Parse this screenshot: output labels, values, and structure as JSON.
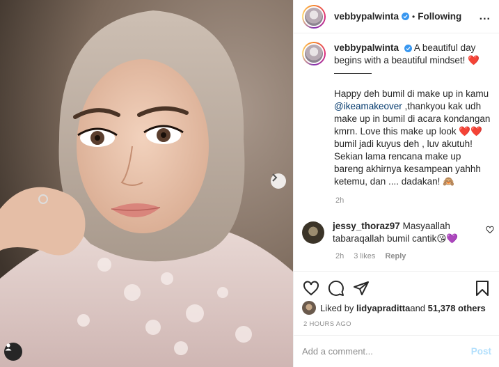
{
  "post": {
    "username": "vebbypalwinta",
    "following_label": "Following",
    "separator": "•",
    "more_label": "...",
    "photo_alt": "hijab portrait"
  },
  "caption": {
    "username": "vebbypalwinta",
    "line1": "A beautiful day begins with a beautiful mindset! ❤️",
    "divider": "————",
    "para_before": "Happy deh bumil di make up in kamu ",
    "mention": "@ikeamakeover",
    "para_after": " ,thankyou kak udh make up in bumil di acara kondangan kmrn. Love this make up look ❤️❤️ bumil jadi kuyus deh , luv akutuh! Sekian lama rencana make up bareng akhirnya kesampean yahhh ketemu, dan .... dadakan! 🙈",
    "time": "2h"
  },
  "comment": {
    "username": "jessy_thoraz97",
    "text": "Masyaallah tabaraqallah bumil cantik😘💜",
    "time": "2h",
    "likes": "3 likes",
    "reply": "Reply"
  },
  "likes": {
    "prefix": "Liked by ",
    "user": "lidyapraditta",
    "and": " and ",
    "others": "51,378 others"
  },
  "timestamp": "2 HOURS AGO",
  "add_comment": {
    "placeholder": "Add a comment...",
    "post_label": "Post"
  },
  "colors": {
    "verified": "#3897f0",
    "link": "#00376b",
    "muted": "#8e8e8e",
    "post_disabled": "#b2dffc"
  },
  "icons": [
    "verified-badge-icon",
    "heart-icon",
    "comment-icon",
    "share-icon",
    "bookmark-icon",
    "next-arrow-icon",
    "user-tag-icon"
  ]
}
